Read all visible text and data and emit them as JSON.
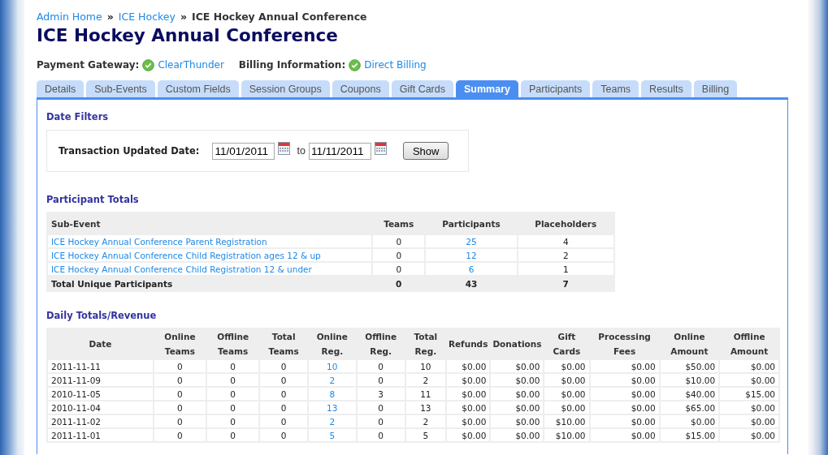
{
  "breadcrumb": {
    "items": [
      {
        "label": "Admin Home",
        "link": true
      },
      {
        "label": "ICE Hockey",
        "link": true
      },
      {
        "label": "ICE Hockey Annual Conference",
        "link": false
      }
    ],
    "separators": [
      "»",
      "»"
    ]
  },
  "title": "ICE Hockey Annual Conference",
  "status": [
    {
      "label": "Payment Gateway:",
      "value": "ClearThunder",
      "ok": true
    },
    {
      "label": "Billing Information:",
      "value": "Direct Billing",
      "ok": true
    }
  ],
  "tabs": [
    {
      "label": "Details",
      "selected": false
    },
    {
      "label": "Sub-Events",
      "selected": false
    },
    {
      "label": "Custom Fields",
      "selected": false
    },
    {
      "label": "Session Groups",
      "selected": false
    },
    {
      "label": "Coupons",
      "selected": false
    },
    {
      "label": "Gift Cards",
      "selected": false
    },
    {
      "label": "Summary",
      "selected": true
    },
    {
      "label": "Participants",
      "selected": false
    },
    {
      "label": "Teams",
      "selected": false
    },
    {
      "label": "Results",
      "selected": false
    },
    {
      "label": "Billing",
      "selected": false
    }
  ],
  "date_filters": {
    "heading": "Date Filters",
    "label": "Transaction Updated Date:",
    "from": "11/01/2011",
    "to_label": "to",
    "to": "11/11/2011",
    "button": "Show"
  },
  "participant_totals": {
    "heading": "Participant Totals",
    "columns": [
      {
        "label": "Sub-Event",
        "kind": "text",
        "link": true
      },
      {
        "label": "Teams",
        "kind": "count",
        "link": false
      },
      {
        "label": "Participants",
        "kind": "count",
        "link": true
      },
      {
        "label": "Placeholders",
        "kind": "count",
        "link": false
      }
    ],
    "rows": [
      [
        "ICE Hockey Annual Conference Parent Registration",
        "0",
        "25",
        "4"
      ],
      [
        "ICE Hockey Annual Conference Child Registration ages 12 & up",
        "0",
        "12",
        "2"
      ],
      [
        "ICE Hockey Annual Conference Child Registration 12 & under",
        "0",
        "6",
        "1"
      ]
    ],
    "total_row": [
      "Total Unique Participants",
      "0",
      "43",
      "7"
    ]
  },
  "daily_totals": {
    "heading": "Daily Totals/Revenue",
    "columns": [
      {
        "label": "Date",
        "kind": "text",
        "link": false
      },
      {
        "label": "Online Teams",
        "kind": "count",
        "link": false
      },
      {
        "label": "Offline Teams",
        "kind": "count",
        "link": false
      },
      {
        "label": "Total Teams",
        "kind": "count",
        "link": false
      },
      {
        "label": "Online Reg.",
        "kind": "count",
        "link": true
      },
      {
        "label": "Offline Reg.",
        "kind": "count",
        "link": false
      },
      {
        "label": "Total Reg.",
        "kind": "count",
        "link": false
      },
      {
        "label": "Refunds",
        "kind": "money",
        "link": false
      },
      {
        "label": "Donations",
        "kind": "money",
        "link": false
      },
      {
        "label": "Gift Cards",
        "kind": "money",
        "link": false
      },
      {
        "label": "Processing Fees",
        "kind": "money",
        "link": false
      },
      {
        "label": "Online Amount",
        "kind": "money",
        "link": false
      },
      {
        "label": "Offline Amount",
        "kind": "money",
        "link": false
      }
    ],
    "rows": [
      [
        "2011-11-11",
        "0",
        "0",
        "0",
        "10",
        "0",
        "10",
        "$0.00",
        "$0.00",
        "$0.00",
        "$0.00",
        "$50.00",
        "$0.00"
      ],
      [
        "2011-11-09",
        "0",
        "0",
        "0",
        "2",
        "0",
        "2",
        "$0.00",
        "$0.00",
        "$0.00",
        "$0.00",
        "$10.00",
        "$0.00"
      ],
      [
        "2010-11-05",
        "0",
        "0",
        "0",
        "8",
        "3",
        "11",
        "$0.00",
        "$0.00",
        "$0.00",
        "$0.00",
        "$40.00",
        "$15.00"
      ],
      [
        "2010-11-04",
        "0",
        "0",
        "0",
        "13",
        "0",
        "13",
        "$0.00",
        "$0.00",
        "$0.00",
        "$0.00",
        "$65.00",
        "$0.00"
      ],
      [
        "2011-11-02",
        "0",
        "0",
        "0",
        "2",
        "0",
        "2",
        "$0.00",
        "$0.00",
        "$10.00",
        "$0.00",
        "$0.00",
        "$0.00"
      ],
      [
        "2011-11-01",
        "0",
        "0",
        "0",
        "5",
        "0",
        "5",
        "$0.00",
        "$0.00",
        "$10.00",
        "$0.00",
        "$15.00",
        "$0.00"
      ]
    ]
  }
}
